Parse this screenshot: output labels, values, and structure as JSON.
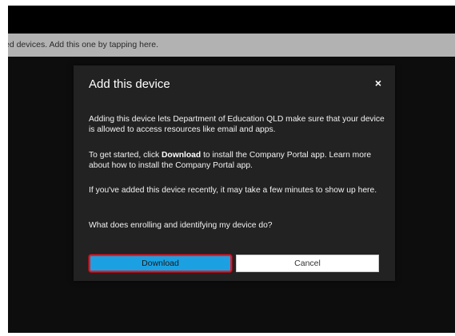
{
  "banner": {
    "text": "ed devices. Add this one by tapping here."
  },
  "dialog": {
    "title": "Add this device",
    "close_glyph": "×",
    "para1": "Adding this device lets Department of Education QLD make sure that your device is allowed to access resources like email and apps.",
    "para2_prefix": "To get started, click ",
    "para2_bold": "Download",
    "para2_suffix": " to install the Company Portal app. Learn more about how to install the Company Portal app.",
    "para3": "If you've added this device recently, it may take a few minutes to show up here.",
    "para4": "What does enrolling and identifying my device do?",
    "download_label": "Download",
    "cancel_label": "Cancel"
  },
  "colors": {
    "download_bg": "#1ba1e2",
    "highlight_border": "#d7202e",
    "dialog_bg": "#222222",
    "banner_bg": "#b2b2b2"
  },
  "icons": {
    "close": "close-icon"
  }
}
